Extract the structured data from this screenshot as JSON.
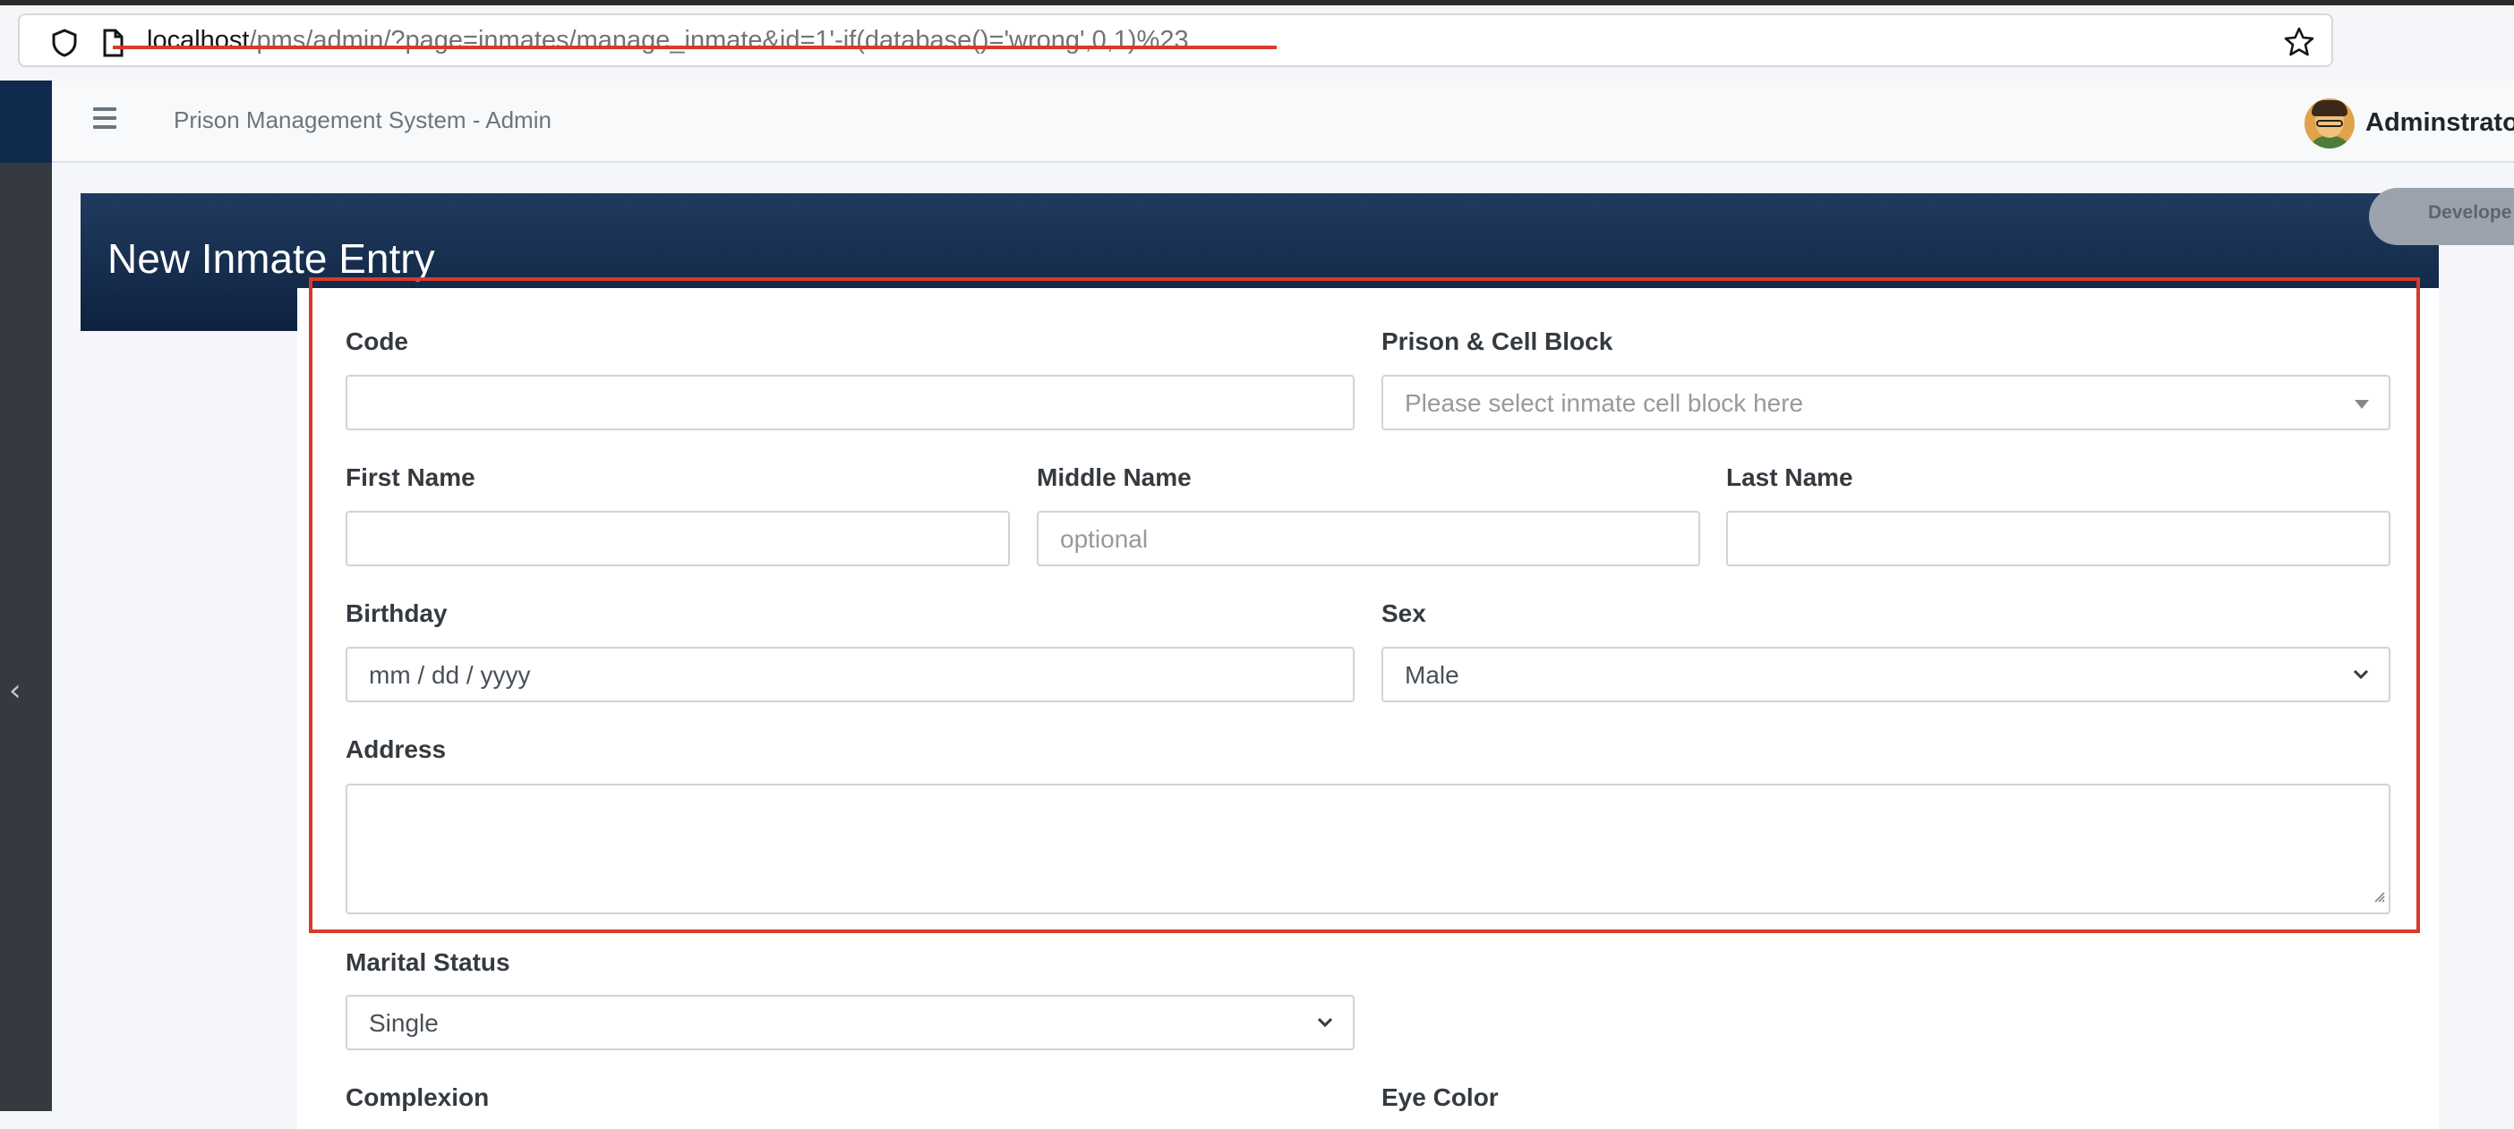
{
  "browser": {
    "url_host": "localhost",
    "url_rest": "/pms/admin/?page=inmates/manage_inmate&id=1'-if(database()='wrong',0,1)%23",
    "icons": [
      "shield-icon",
      "page-icon",
      "bookmark-star-icon"
    ]
  },
  "header": {
    "app_title": "Prison Management System - Admin",
    "user_name": "Adminstrato",
    "icons": [
      "hamburger-icon",
      "avatar"
    ]
  },
  "sidebar": {
    "icons": [
      "collapse-chevron-icon"
    ]
  },
  "page": {
    "title": "New Inmate Entry",
    "dev_badge": "Develope"
  },
  "form": {
    "code": {
      "label": "Code",
      "value": ""
    },
    "prison_cell_block": {
      "label": "Prison & Cell Block",
      "placeholder": "Please select inmate cell block here"
    },
    "first_name": {
      "label": "First Name",
      "value": ""
    },
    "middle_name": {
      "label": "Middle Name",
      "placeholder": "optional"
    },
    "last_name": {
      "label": "Last Name",
      "value": ""
    },
    "birthday": {
      "label": "Birthday",
      "placeholder": "mm / dd / yyyy"
    },
    "sex": {
      "label": "Sex",
      "selected": "Male"
    },
    "address": {
      "label": "Address",
      "value": ""
    },
    "marital_status": {
      "label": "Marital Status",
      "selected": "Single"
    },
    "complexion": {
      "label": "Complexion"
    },
    "eye_color": {
      "label": "Eye Color"
    }
  },
  "colors": {
    "annotation_red": "#d63a2c",
    "banner_navy": "#0e223f",
    "sidebar_dark": "#343a40"
  }
}
